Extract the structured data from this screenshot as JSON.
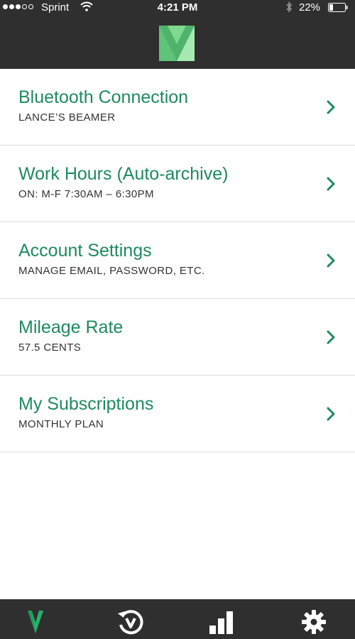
{
  "status_bar": {
    "carrier": "Sprint",
    "time": "4:21 PM",
    "battery": "22%"
  },
  "colors": {
    "accent_green": "#1e8a5f",
    "logo_green": "#7ed98f",
    "bar_background": "#2f2f2f"
  },
  "header": {
    "logo_icon": "app-logo-icon"
  },
  "settings": {
    "items": [
      {
        "title": "Bluetooth Connection",
        "subtitle": "LANCE’S BEAMER"
      },
      {
        "title": "Work Hours (Auto-archive)",
        "subtitle": "ON: M-F 7:30AM – 6:30PM"
      },
      {
        "title": "Account Settings",
        "subtitle": "MANAGE EMAIL, PASSWORD, ETC."
      },
      {
        "title": "Mileage Rate",
        "subtitle": "57.5 CENTS"
      },
      {
        "title": "My Subscriptions",
        "subtitle": "MONTHLY PLAN"
      }
    ]
  },
  "tabbar": {
    "tabs": [
      {
        "icon": "home-logo-icon",
        "active": true
      },
      {
        "icon": "history-icon",
        "active": false
      },
      {
        "icon": "stats-bars-icon",
        "active": false
      },
      {
        "icon": "gear-icon",
        "active": false
      }
    ]
  }
}
